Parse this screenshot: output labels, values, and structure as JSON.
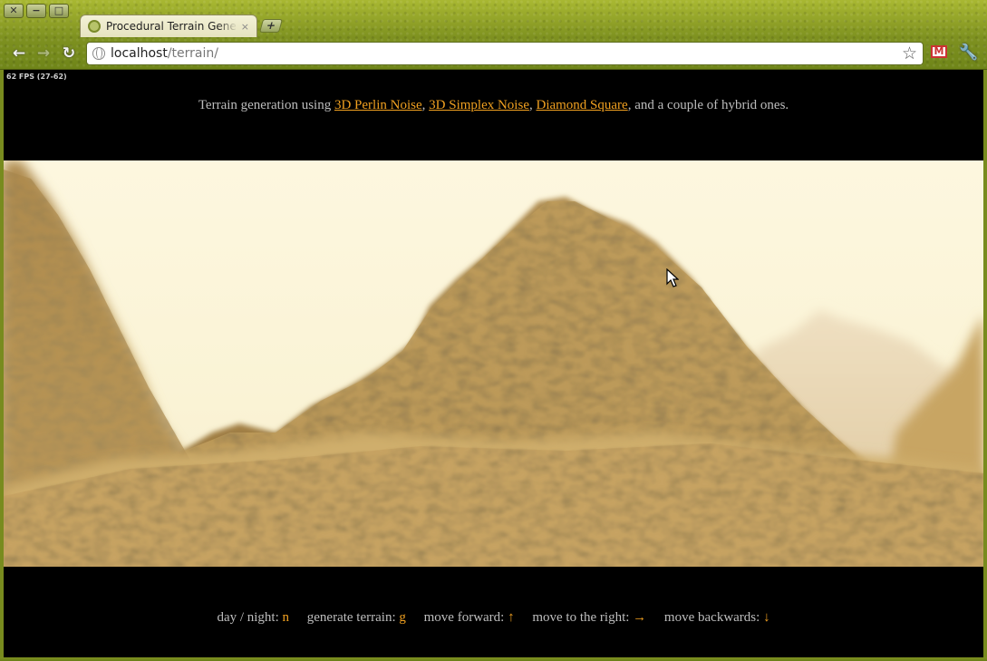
{
  "browser": {
    "window_buttons": [
      "✕",
      "−",
      "□"
    ],
    "tab": {
      "title": "Procedural Terrain Gener",
      "close": "×"
    },
    "new_tab": "+",
    "nav": {
      "back": "←",
      "forward": "→",
      "reload": "↻"
    },
    "url": {
      "host": "localhost",
      "path": "/terrain/"
    },
    "bookmark_icon": "star-icon",
    "gmail_label": "M",
    "wrench_icon": "wrench-icon"
  },
  "page": {
    "fps": "62 FPS (27-62)",
    "intro": {
      "prefix": "Terrain generation using ",
      "links": [
        "3D Perlin Noise",
        "3D Simplex Noise",
        "Diamond Square"
      ],
      "sep": ", ",
      "suffix": ", and a couple of hybrid ones."
    },
    "controls": [
      {
        "label": "day / night:",
        "key": "n"
      },
      {
        "label": "generate terrain:",
        "key": "g"
      },
      {
        "label": "move forward:",
        "key": "↑"
      },
      {
        "label": "move to the right:",
        "key": "→"
      },
      {
        "label": "move backwards:",
        "key": "↓"
      }
    ]
  },
  "colors": {
    "accent": "#f0a020",
    "sky": "#fdf7df",
    "terrain_light": "#c9a865",
    "terrain_dark": "#6e5226",
    "chrome": "#8a9d25"
  }
}
